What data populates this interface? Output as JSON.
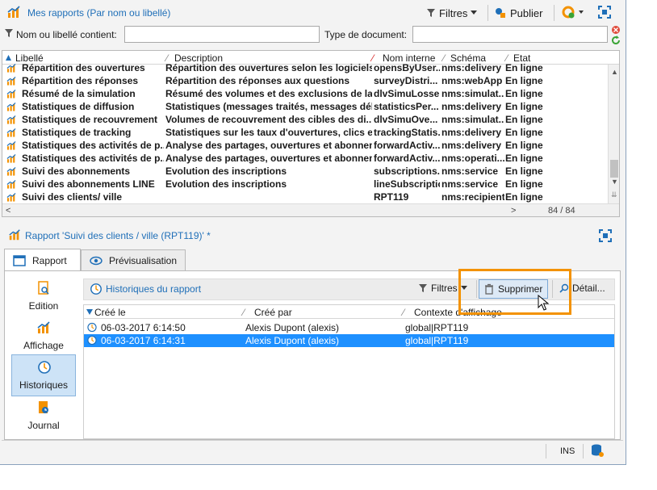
{
  "top_panel": {
    "title": "Mes rapports (Par nom ou libellé)",
    "filtres_label": "Filtres",
    "publier_label": "Publier"
  },
  "search": {
    "name_label": "Nom ou libellé contient:",
    "name_value": "",
    "doc_type_label": "Type de document:",
    "doc_type_value": ""
  },
  "reports_table": {
    "columns": [
      "Libellé",
      "Description",
      "Nom interne",
      "Schéma",
      "Etat"
    ],
    "rows": [
      [
        "Répartition des ouvertures",
        "Répartition des ouvertures selon les logiciels...",
        "opensByUser...",
        "nms:delivery",
        "En ligne"
      ],
      [
        "Répartition des réponses",
        "Répartition des réponses aux questions",
        "surveyDistri...",
        "nms:webApp",
        "En ligne"
      ],
      [
        "Résumé de la simulation",
        "Résumé des volumes et des exclusions de la s...",
        "dlvSimuLosse...",
        "nms:simulat...",
        "En ligne"
      ],
      [
        "Statistiques de diffusion",
        "Statistiques (messages traités, messages déli...",
        "statisticsPer...",
        "nms:delivery",
        "En ligne"
      ],
      [
        "Statistiques de recouvrement",
        "Volumes de recouvrement des cibles des di...",
        "dlvSimuOve...",
        "nms:simulat...",
        "En ligne"
      ],
      [
        "Statistiques de tracking",
        "Statistiques sur les taux d'ouvertures, clics e...",
        "trackingStatis...",
        "nms:delivery",
        "En ligne"
      ],
      [
        "Statistiques des activités de p...",
        "Analyse des partages, ouvertures et abonnem...",
        "forwardActiv...",
        "nms:delivery",
        "En ligne"
      ],
      [
        "Statistiques des activités de p...",
        "Analyse des partages, ouvertures et abonnem...",
        "forwardActiv...",
        "nms:operati...",
        "En ligne"
      ],
      [
        "Suivi des abonnements",
        "Evolution des inscriptions",
        "subscriptions...",
        "nms:service",
        "En ligne"
      ],
      [
        "Suivi des abonnements LINE",
        "Evolution des inscriptions",
        "lineSubscriptio",
        "nms:service",
        "En ligne"
      ],
      [
        "Suivi des clients/ ville",
        "",
        "RPT119",
        "nms:recipient",
        "En ligne"
      ]
    ],
    "count": "84 / 84"
  },
  "detail_panel": {
    "title": "Rapport 'Suivi des clients / ville (RPT119)' *",
    "tabs": [
      "Rapport",
      "Prévisualisation"
    ],
    "sidebar": [
      "Edition",
      "Affichage",
      "Historiques",
      "Journal"
    ],
    "history_title": "Historiques du rapport",
    "filtres_label": "Filtres",
    "supprimer_label": "Supprimer",
    "detail_label": "Détail...",
    "history_columns": [
      "Créé le",
      "Créé par",
      "Contexte d'affichage"
    ],
    "history_rows": [
      [
        "06-03-2017 6:14:50",
        "Alexis Dupont (alexis)",
        "global|RPT119"
      ],
      [
        "06-03-2017 6:14:31",
        "Alexis Dupont (alexis)",
        "global|RPT119"
      ]
    ]
  },
  "status_bar": {
    "mode": "INS"
  },
  "colors": {
    "accent": "#1f6fb8",
    "highlight": "#f39200",
    "selection": "#1e90ff"
  }
}
